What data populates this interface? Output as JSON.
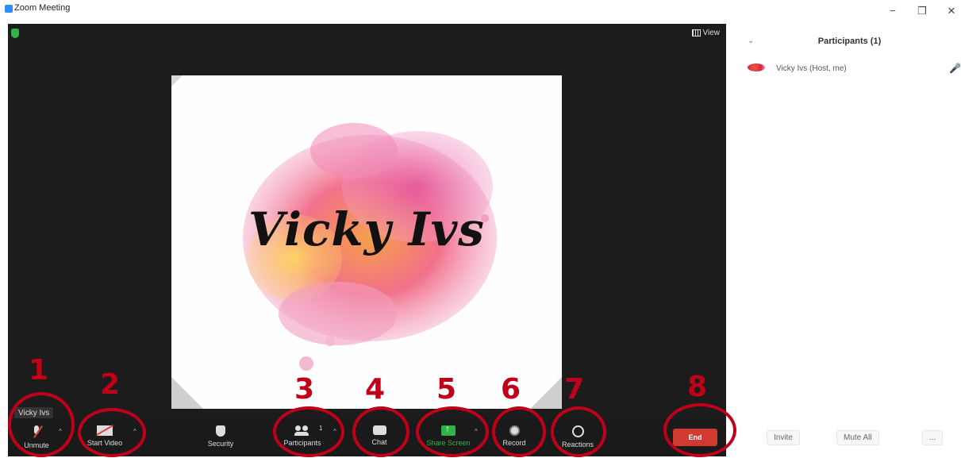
{
  "window": {
    "title": "Zoom Meeting",
    "controls": {
      "minimize": "−",
      "restore": "❐",
      "close": "✕"
    }
  },
  "meeting": {
    "view_label": "View",
    "shared_content_text": "Vicky Ivs",
    "name_label": "Vicky Ivs"
  },
  "toolbar": {
    "unmute": "Unmute",
    "start_video": "Start Video",
    "security": "Security",
    "participants": "Participants",
    "participants_count": "1",
    "chat": "Chat",
    "share_screen": "Share Screen",
    "record": "Record",
    "reactions": "Reactions",
    "end": "End"
  },
  "annotations": [
    "1",
    "2",
    "3",
    "4",
    "5",
    "6",
    "7",
    "8"
  ],
  "participants_panel": {
    "title": "Participants (1)",
    "participant_name": "Vicky Ivs (Host, me)",
    "invite": "Invite",
    "mute_all": "Mute All",
    "more": "..."
  },
  "colors": {
    "end_button": "#d13a30",
    "share_screen": "#2fb34a",
    "annotation": "#c00018"
  }
}
